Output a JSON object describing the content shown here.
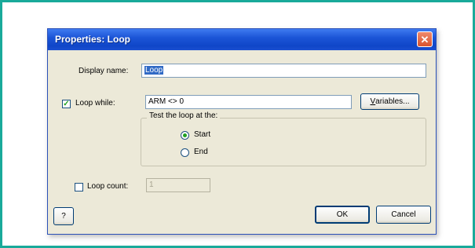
{
  "dialog": {
    "title": "Properties: Loop",
    "close_symbol": "✕"
  },
  "display_name": {
    "label": "Display name:",
    "value": "Loop"
  },
  "loop_while": {
    "checked": true,
    "label": "Loop while:",
    "value": "ARM <> 0",
    "variables_button": {
      "underlined": "V",
      "rest": "ariables..."
    }
  },
  "test_group": {
    "title": "Test the loop at the:",
    "options": [
      {
        "label": "Start",
        "selected": true
      },
      {
        "label": "End",
        "selected": false
      }
    ]
  },
  "loop_count": {
    "checked": false,
    "label": "Loop count:",
    "value": "1"
  },
  "buttons": {
    "help": "?",
    "ok": "OK",
    "cancel": "Cancel"
  },
  "colors": {
    "frame_border": "#19aa9a",
    "titlebar": "#1c55d7",
    "dialog_face": "#ece9d8",
    "close_button": "#d8532f",
    "selection": "#316ac5"
  },
  "icons": {
    "close": "close-icon",
    "check": "checkmark-icon",
    "radio": "radio-dot-icon"
  }
}
